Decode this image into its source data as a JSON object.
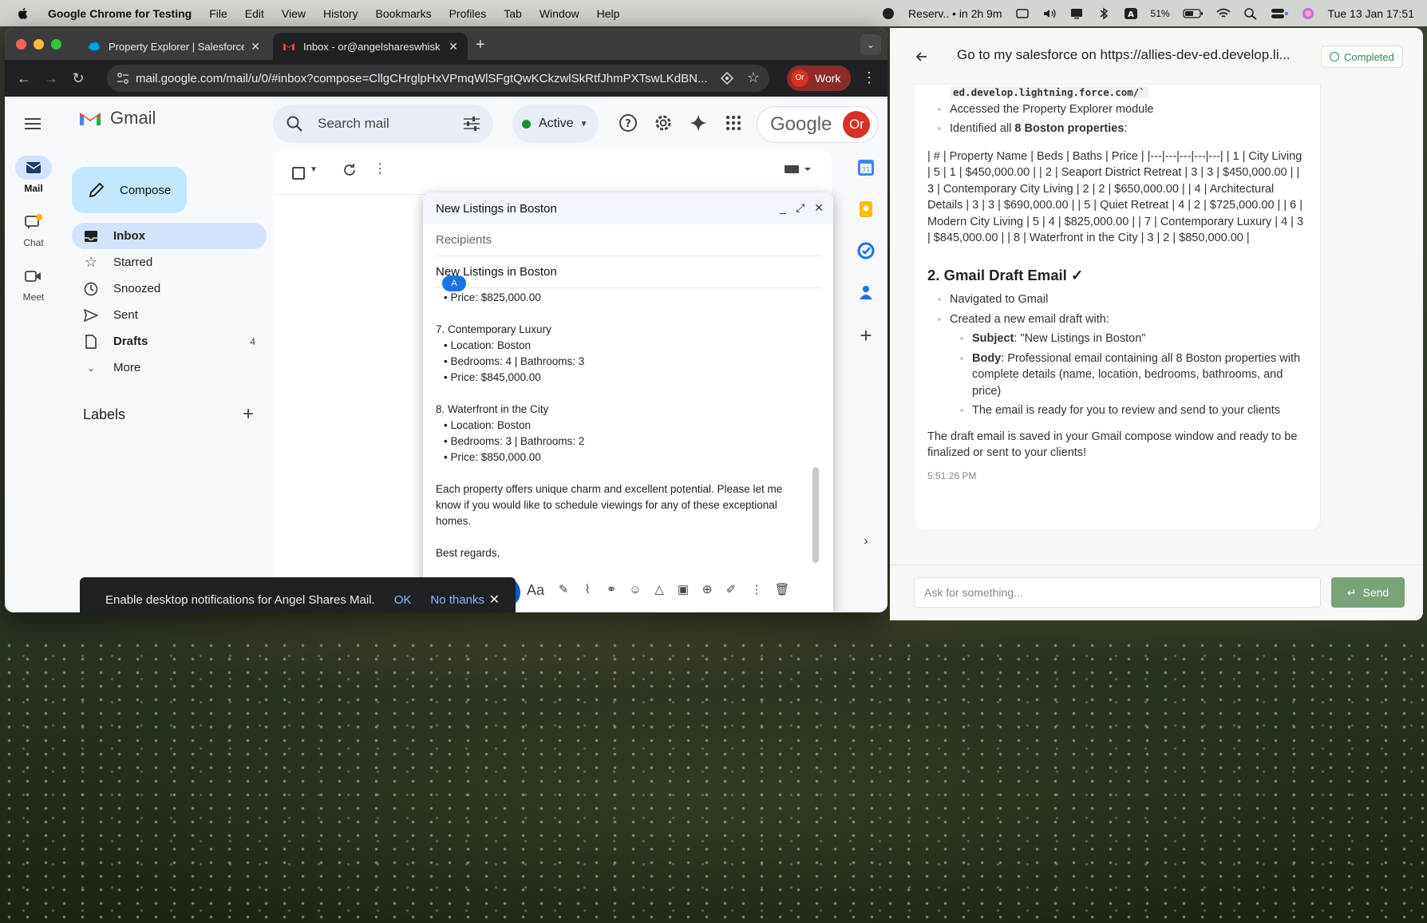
{
  "menubar": {
    "app_name": "Google Chrome for Testing",
    "menus": [
      "File",
      "Edit",
      "View",
      "History",
      "Bookmarks",
      "Profiles",
      "Tab",
      "Window",
      "Help"
    ],
    "reservation": "Reserv.. • in 2h 9m",
    "battery": "51%",
    "datetime": "Tue 13 Jan  17:51"
  },
  "browser": {
    "tabs": [
      {
        "label": "Property Explorer | Salesforce"
      },
      {
        "label": "Inbox - or@angelshareswhisk"
      }
    ],
    "url": "mail.google.com/mail/u/0/#inbox?compose=CllgCHrglpHxVPmqWlSFgtQwKCkzwlSkRtfJhmPXTswLKdBN...",
    "profile_label": "Work",
    "profile_initials": "Or"
  },
  "gmail": {
    "logo_text": "Gmail",
    "search_placeholder": "Search mail",
    "status": "Active",
    "account_initials": "Or",
    "google_word": "Google",
    "rail": [
      {
        "label": "Mail"
      },
      {
        "label": "Chat"
      },
      {
        "label": "Meet"
      }
    ],
    "compose_label": "Compose",
    "nav": [
      {
        "label": "Inbox",
        "count": ""
      },
      {
        "label": "Starred",
        "count": ""
      },
      {
        "label": "Snoozed",
        "count": ""
      },
      {
        "label": "Sent",
        "count": ""
      },
      {
        "label": "Drafts",
        "count": "4"
      },
      {
        "label": "More",
        "count": ""
      }
    ],
    "labels_heading": "Labels"
  },
  "compose": {
    "title": "New Listings in Boston",
    "recipients_placeholder": "Recipients",
    "subject": "New Listings in Boston",
    "avatar_letter": "A",
    "body_lines": {
      "l1": "• Price: $825,000.00",
      "l2": "7. Contemporary Luxury",
      "l3": "• Location: Boston",
      "l4": "• Bedrooms: 4 | Bathrooms: 3",
      "l5": "• Price: $845,000.00",
      "l6": "8. Waterfront in the City",
      "l7": "• Location: Boston",
      "l8": "• Bedrooms: 3 | Bathrooms: 2",
      "l9": "• Price: $850,000.00",
      "para": "Each property offers unique charm and excellent potential. Please let me know if you would like to schedule viewings for any of these exceptional homes.",
      "closing": "Best regards,"
    },
    "format_label": "Aa"
  },
  "snackbar": {
    "message": "Enable desktop notifications for Angel Shares Mail.",
    "ok": "OK",
    "no_thanks": "No thanks"
  },
  "assistant": {
    "title": "Go to my salesforce on https://allies-dev-ed.develop.li...",
    "status": "Completed",
    "code_snippet": "ed.develop.lightning.force.com/`",
    "bullets_top": {
      "b1": "Accessed the Property Explorer module",
      "b2_prefix": "Identified all ",
      "b2_bold": "8 Boston properties",
      "b2_suffix": ":"
    },
    "table_text": "| # | Property Name | Beds | Baths | Price | |---|---|---|---|---| | 1 | City Living | 5 | 1 | $450,000.00 | | 2 | Seaport District Retreat | 3 | 3 | $450,000.00 | | 3 | Contemporary City Living | 2 | 2 | $650,000.00 | | 4 | Architectural Details | 3 | 3 | $690,000.00 | | 5 | Quiet Retreat | 4 | 2 | $725,000.00 | | 6 | Modern City Living | 5 | 4 | $825,000.00 | | 7 | Contemporary Luxury | 4 | 3 | $845,000.00 | | 8 | Waterfront in the City | 3 | 2 | $850,000.00 |",
    "section_heading": "2. Gmail Draft Email ✓",
    "steps": {
      "s1": "Navigated to Gmail",
      "s2": "Created a new email draft with:",
      "subject_label": "Subject",
      "subject_value": ": \"New Listings in Boston\"",
      "body_label": "Body",
      "body_value": ": Professional email containing all 8 Boston properties with complete details (name, location, bedrooms, bathrooms, and price)",
      "ready": "The email is ready for you to review and send to your clients"
    },
    "final_text": "The draft email is saved in your Gmail compose window and ready to be finalized or sent to your clients!",
    "timestamp": "5:51:26 PM",
    "input_placeholder": "Ask for something...",
    "send_label": "Send"
  },
  "colors": {
    "gmail_compose_bg": "#c2e7ff",
    "gmail_active_nav": "#d3e3fd",
    "send_blue": "#0b57d0",
    "assistant_send": "#7aa37a",
    "completed_green": "#2e8b57"
  }
}
